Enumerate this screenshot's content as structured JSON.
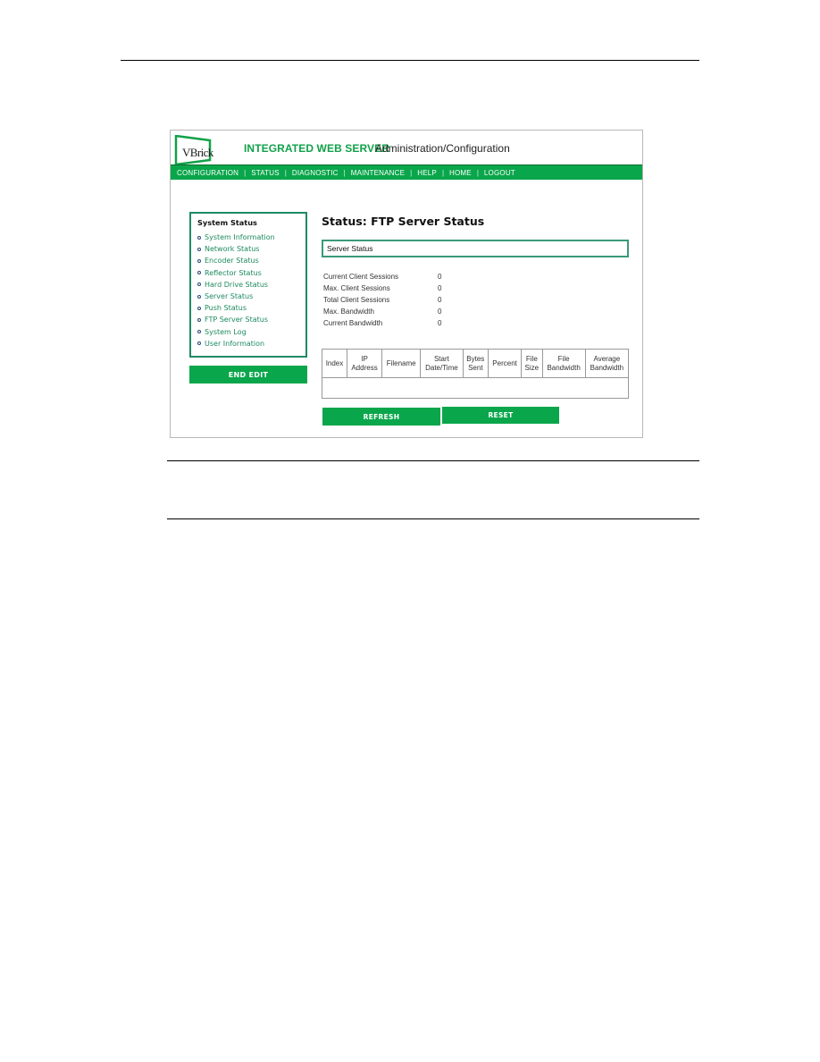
{
  "header": {
    "logo_text": "VBrick",
    "brand": "INTEGRATED WEB SERVER",
    "subtitle": "Administration/Configuration",
    "brand_color": "#12a14a"
  },
  "nav": {
    "items": [
      "CONFIGURATION",
      "STATUS",
      "DIAGNOSTIC",
      "MAINTENANCE",
      "HELP",
      "HOME",
      "LOGOUT"
    ],
    "separator": "|",
    "bar_color": "#0aa64b"
  },
  "sidebar": {
    "title": "System Status",
    "items": [
      "System Information",
      "Network Status",
      "Encoder Status",
      "Reflector Status",
      "Hard Drive Status",
      "Server Status",
      "Push Status",
      "FTP Server Status",
      "System Log",
      "User Information"
    ],
    "end_edit_label": "END EDIT"
  },
  "main": {
    "page_title": "Status: FTP Server Status",
    "section_title": "Server Status",
    "stats": [
      {
        "label": "Current Client Sessions",
        "value": "0"
      },
      {
        "label": "Max. Client Sessions",
        "value": "0"
      },
      {
        "label": "Total Client Sessions",
        "value": "0"
      },
      {
        "label": "Max. Bandwidth",
        "value": "0"
      },
      {
        "label": "Current Bandwidth",
        "value": "0"
      }
    ],
    "table": {
      "columns": [
        [
          "Index"
        ],
        [
          "IP",
          "Address"
        ],
        [
          "Filename"
        ],
        [
          "Start",
          "Date/Time"
        ],
        [
          "Bytes",
          "Sent"
        ],
        [
          "Percent"
        ],
        [
          "File",
          "Size"
        ],
        [
          "File",
          "Bandwidth"
        ],
        [
          "Average",
          "Bandwidth"
        ]
      ],
      "rows": []
    },
    "buttons": {
      "refresh": "REFRESH",
      "reset": "RESET"
    }
  }
}
